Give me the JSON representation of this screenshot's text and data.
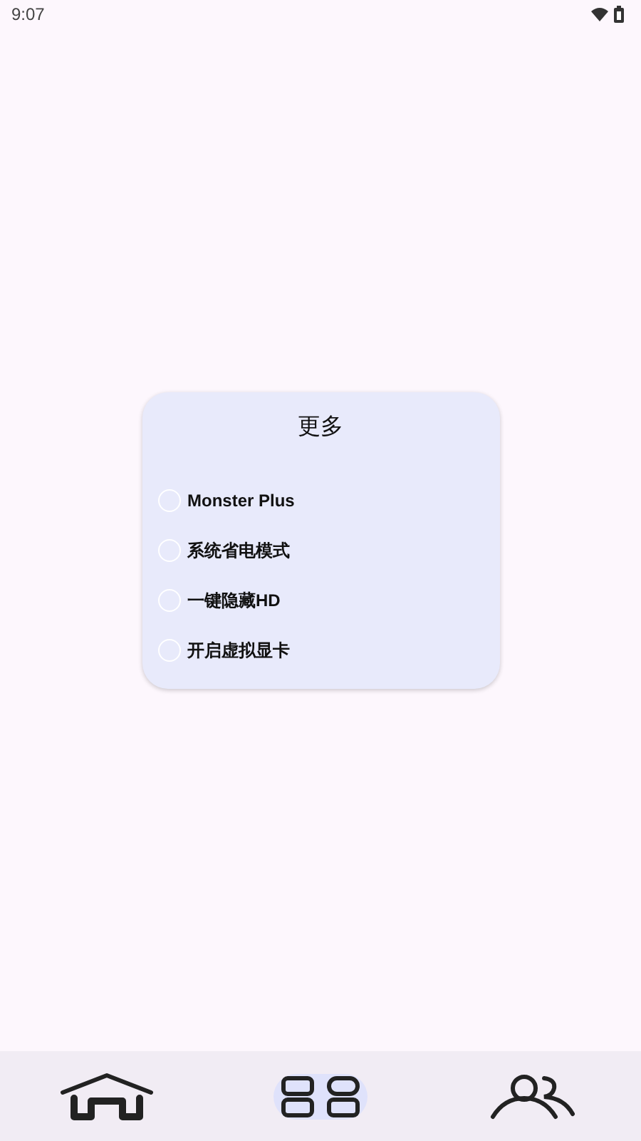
{
  "status_bar": {
    "time": "9:07"
  },
  "dialog": {
    "title": "更多",
    "options": [
      {
        "label": "Monster Plus",
        "selected": false
      },
      {
        "label": "系统省电模式",
        "selected": false
      },
      {
        "label": "一键隐藏HD",
        "selected": false
      },
      {
        "label": "开启虚拟显卡",
        "selected": false
      }
    ]
  },
  "bottom_nav": {
    "items": [
      {
        "kind": "home",
        "selected": false
      },
      {
        "kind": "apps",
        "selected": true
      },
      {
        "kind": "people",
        "selected": false
      }
    ]
  }
}
